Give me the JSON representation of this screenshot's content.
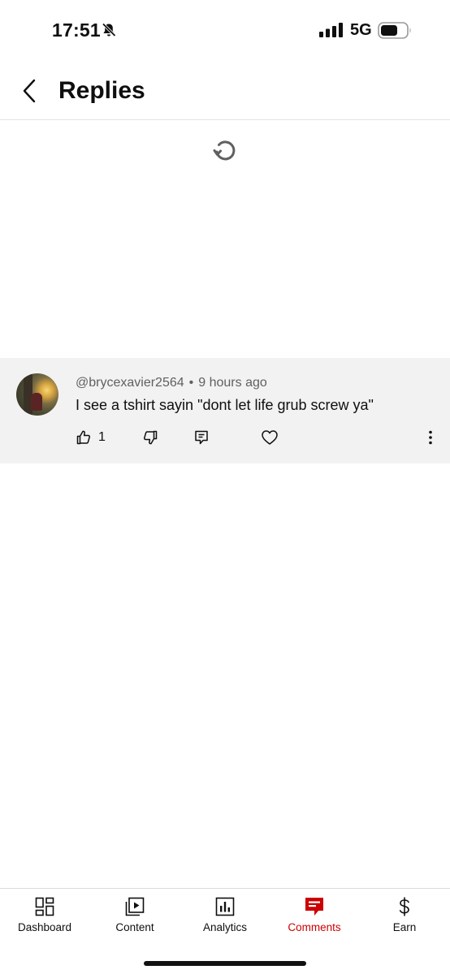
{
  "status_bar": {
    "time": "17:51",
    "network": "5G",
    "icons": [
      "bell-off-icon",
      "signal-icon",
      "battery-icon"
    ]
  },
  "header": {
    "title": "Replies",
    "back_icon": "chevron-left-icon"
  },
  "loading": {
    "icon": "refresh-icon"
  },
  "comment": {
    "author": "@brycexavier2564",
    "separator": "•",
    "time_ago": "9 hours ago",
    "text": "I see a tshirt sayin \"dont let life grub screw ya\"",
    "like_count": "1",
    "actions": [
      "thumbs-up-icon",
      "thumbs-down-icon",
      "reply-icon",
      "heart-icon",
      "more-vert-icon"
    ]
  },
  "bottom_nav": {
    "active": "Comments",
    "accent_color": "#cc0000",
    "items": [
      {
        "label": "Dashboard",
        "icon": "dashboard-icon"
      },
      {
        "label": "Content",
        "icon": "content-icon"
      },
      {
        "label": "Analytics",
        "icon": "analytics-icon"
      },
      {
        "label": "Comments",
        "icon": "comments-icon"
      },
      {
        "label": "Earn",
        "icon": "dollar-icon"
      }
    ]
  }
}
